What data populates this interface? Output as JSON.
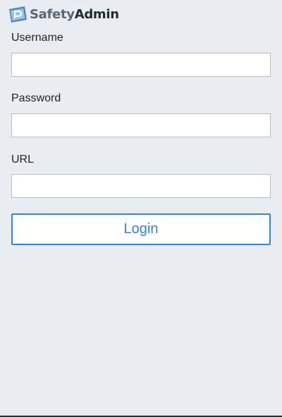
{
  "header": {
    "logo_part1": "Safety",
    "logo_part2": "Admin",
    "logo_icon": "safetyadmin-logo-icon",
    "colors": {
      "logo_icon_primary": "#4d86c6",
      "logo_icon_secondary": "#9ec3e8",
      "logo_text_light": "#5b6670",
      "logo_text_dark": "#1f2a33"
    }
  },
  "form": {
    "username": {
      "label": "Username",
      "value": "",
      "placeholder": ""
    },
    "password": {
      "label": "Password",
      "value": "",
      "placeholder": ""
    },
    "url": {
      "label": "URL",
      "value": "",
      "placeholder": ""
    },
    "login_label": "Login"
  },
  "theme": {
    "background": "#e9edf1",
    "accent": "#2f86d6",
    "input_border": "#b9bec3"
  }
}
